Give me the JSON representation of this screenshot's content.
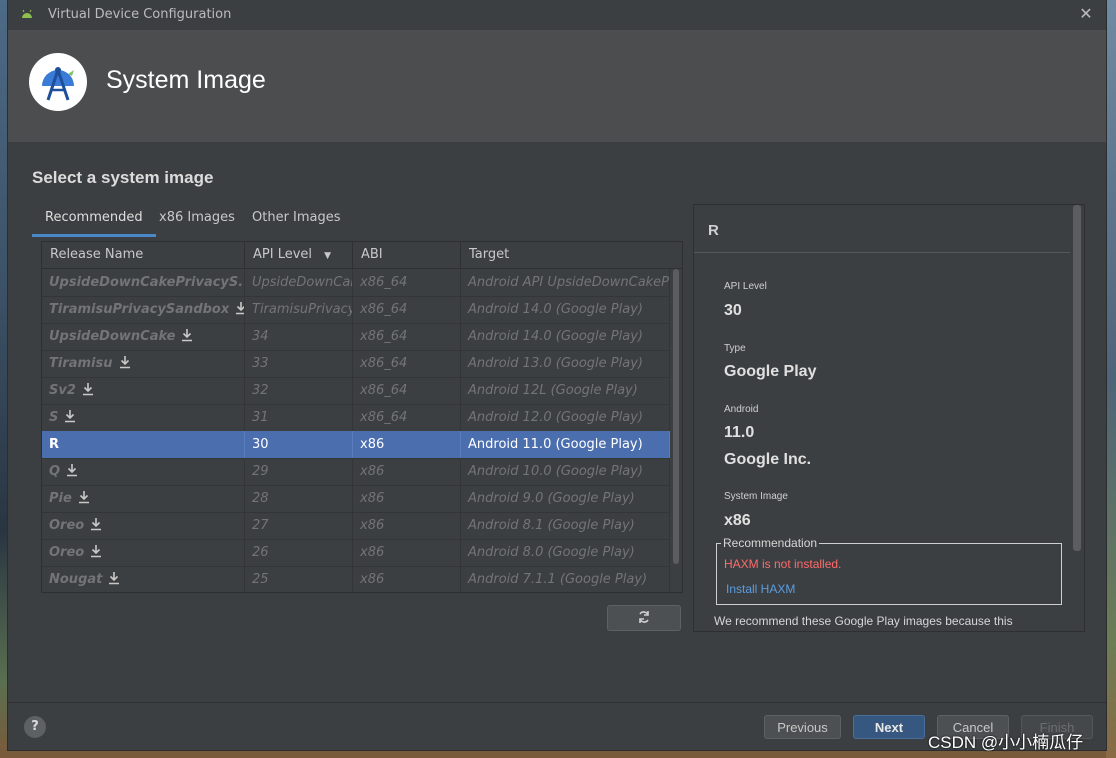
{
  "window": {
    "title": "Virtual Device Configuration",
    "close_glyph": "✕"
  },
  "header": {
    "title": "System Image"
  },
  "page": {
    "subtitle": "Select a system image"
  },
  "tabs": [
    {
      "label": "Recommended",
      "active": true
    },
    {
      "label": "x86 Images",
      "active": false
    },
    {
      "label": "Other Images",
      "active": false
    }
  ],
  "table": {
    "columns": [
      "Release Name",
      "API Level",
      "ABI",
      "Target"
    ],
    "sort_glyph": "▼",
    "rows": [
      {
        "name": "UpsideDownCakePrivacyS...",
        "api": "UpsideDownCake",
        "abi": "x86_64",
        "target": "Android API UpsideDownCakePrivacySandbox",
        "download": true
      },
      {
        "name": "TiramisuPrivacySandbox",
        "api": "TiramisuPrivacySandbox",
        "abi": "x86_64",
        "target": "Android 14.0 (Google Play)",
        "download": true
      },
      {
        "name": "UpsideDownCake",
        "api": "34",
        "abi": "x86_64",
        "target": "Android 14.0 (Google Play)",
        "download": true
      },
      {
        "name": "Tiramisu",
        "api": "33",
        "abi": "x86_64",
        "target": "Android 13.0 (Google Play)",
        "download": true
      },
      {
        "name": "Sv2",
        "api": "32",
        "abi": "x86_64",
        "target": "Android 12L (Google Play)",
        "download": true
      },
      {
        "name": "S",
        "api": "31",
        "abi": "x86_64",
        "target": "Android 12.0 (Google Play)",
        "download": true
      },
      {
        "name": "R",
        "api": "30",
        "abi": "x86",
        "target": "Android 11.0 (Google Play)",
        "download": false
      },
      {
        "name": "Q",
        "api": "29",
        "abi": "x86",
        "target": "Android 10.0 (Google Play)",
        "download": true
      },
      {
        "name": "Pie",
        "api": "28",
        "abi": "x86",
        "target": "Android 9.0 (Google Play)",
        "download": true
      },
      {
        "name": "Oreo",
        "api": "27",
        "abi": "x86",
        "target": "Android 8.1 (Google Play)",
        "download": true
      },
      {
        "name": "Oreo",
        "api": "26",
        "abi": "x86",
        "target": "Android 8.0 (Google Play)",
        "download": true
      },
      {
        "name": "Nougat",
        "api": "25",
        "abi": "x86",
        "target": "Android 7.1.1 (Google Play)",
        "download": true
      }
    ],
    "selected_index": 6
  },
  "details": {
    "title": "R",
    "api_level_label": "API Level",
    "api_level": "30",
    "type_label": "Type",
    "type": "Google Play",
    "android_label": "Android",
    "android_version": "11.0",
    "vendor": "Google Inc.",
    "system_image_label": "System Image",
    "system_image": "x86",
    "recommendation_label": "Recommendation",
    "warning": "HAXM is not installed.",
    "install_link": "Install HAXM",
    "description": "We recommend these Google Play images because this"
  },
  "footer": {
    "help": "?",
    "previous": "Previous",
    "next": "Next",
    "cancel": "Cancel",
    "finish": "Finish"
  },
  "watermark": "CSDN @小小楠瓜仔"
}
